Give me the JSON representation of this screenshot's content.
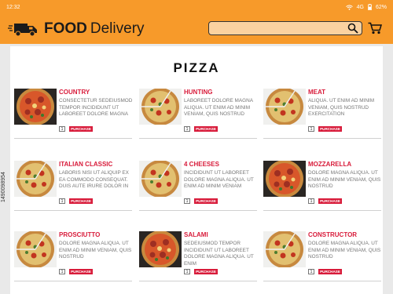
{
  "status_bar": {
    "time": "12:32",
    "network": "4G",
    "battery": "62%"
  },
  "header": {
    "brand_bold": "FOOD",
    "brand_light": "Delivery"
  },
  "search": {
    "placeholder": "",
    "value": ""
  },
  "colors": {
    "header": "#f79a2a",
    "accent": "#d81b3a",
    "panel": "#ffffff",
    "background": "#e9e9e9"
  },
  "page": {
    "title": "PIZZA"
  },
  "products": [
    {
      "name": "COUNTRY",
      "description": "CONSECTETUR SEDEIUSMOD TEMPOR INCIDIDUNT UT LABOREET DOLORE MAGNA",
      "quantity": "1",
      "button": "PURCHASE"
    },
    {
      "name": "HUNTING",
      "description": "LABOREET DOLORE MAGNA ALIQUA. UT ENIM AD MINIM VENIAM, QUIS NOSTRUD",
      "quantity": "1",
      "button": "PURCHASE"
    },
    {
      "name": "MEAT",
      "description": "ALIQUA. UT ENIM AD MINIM VENIAM, QUIS NOSTRUD EXERCITATION",
      "quantity": "1",
      "button": "PURCHASE"
    },
    {
      "name": "ITALIAN CLASSIC",
      "description": "LABORIS NISI UT ALIQUIP EX EA COMMODO CONSEQUAT. DUIS AUTE IRURE DOLOR IN",
      "quantity": "1",
      "button": "PURCHASE"
    },
    {
      "name": "4 CHEESES",
      "description": "INCIDIDUNT UT LABOREET DOLORE MAGNA ALIQUA. UT ENIM AD MINIM VENIAM",
      "quantity": "1",
      "button": "PURCHASE"
    },
    {
      "name": "MOZZARELLA",
      "description": "DOLORE MAGNA ALIQUA. UT ENIM AD MINIM VENIAM, QUIS NOSTRUD",
      "quantity": "1",
      "button": "PURCHASE"
    },
    {
      "name": "PROSCIUTTO",
      "description": "DOLORE MAGNA ALIQUA. UT ENIM AD MINIM VENIAM, QUIS NOSTRUD",
      "quantity": "1",
      "button": "PURCHASE"
    },
    {
      "name": "SALAMI",
      "description": "SEDEIUSMOD TEMPOR INCIDIDUNT UT LABOREET DOLORE MAGNA ALIQUA. UT ENIM",
      "quantity": "1",
      "button": "PURCHASE"
    },
    {
      "name": "CONSTRUCTOR",
      "description": "DOLORE MAGNA ALIQUA. UT ENIM AD MINIM VENIAM, QUIS NOSTRUD",
      "quantity": "1",
      "button": "PURCHASE"
    }
  ],
  "watermark": {
    "text": "1490098954"
  }
}
